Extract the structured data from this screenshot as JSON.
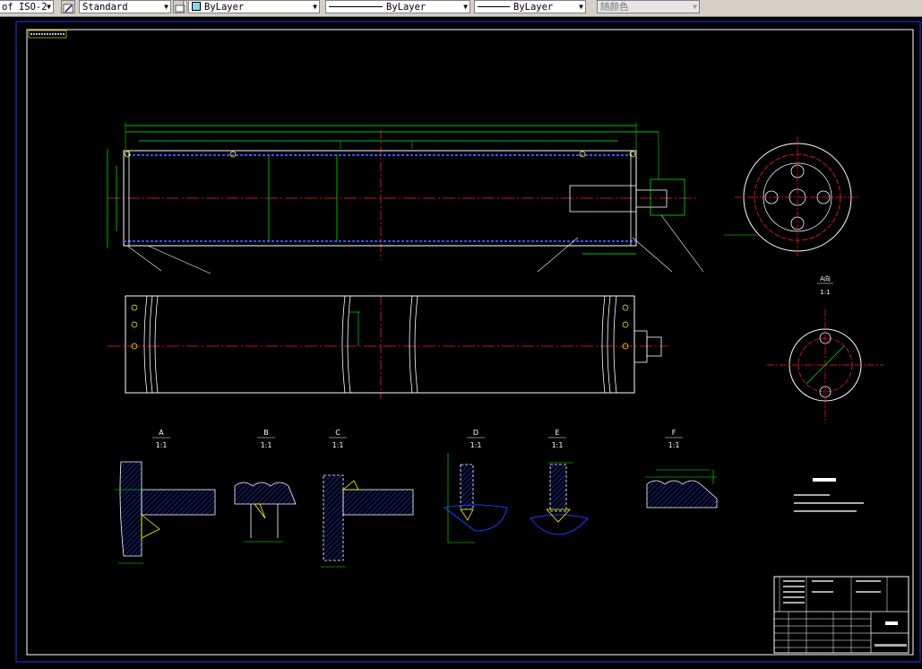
{
  "toolbar": {
    "dimstyle": "of ISO-2",
    "textstyle": "Standard",
    "layer": "ByLayer",
    "linetype": "ByLayer",
    "lineweight": "ByLayer",
    "color": "随颜色"
  },
  "drawing": {
    "views": [
      {
        "letter": "A",
        "scale": "1:1"
      },
      {
        "letter": "B",
        "scale": "1:1"
      },
      {
        "letter": "C",
        "scale": "1:1"
      },
      {
        "letter": "D",
        "scale": "1:1"
      },
      {
        "letter": "E",
        "scale": "1:1"
      },
      {
        "letter": "F",
        "scale": "1:1"
      }
    ],
    "side_view": {
      "letter": "A向",
      "scale": "1:1"
    }
  },
  "colors": {
    "outline": "#ffffff",
    "center": "#ff2020",
    "dimension": "#00ff00",
    "highlight": "#ffff00",
    "hatch": "#0033ff",
    "border": "#1e3cff"
  }
}
